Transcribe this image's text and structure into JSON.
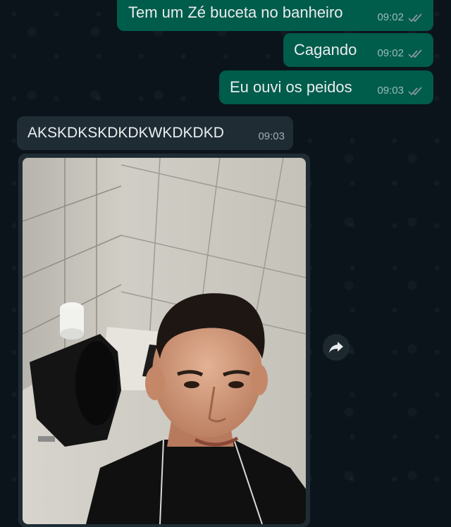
{
  "messages": [
    {
      "text": "Tem um Zé buceta no banheiro",
      "time": "09:02",
      "status": "read"
    },
    {
      "text": "Cagando",
      "time": "09:02",
      "status": "read"
    },
    {
      "text": "Eu ouvi os peidos",
      "time": "09:03",
      "status": "read"
    },
    {
      "text": "AKSKDKSKDKDKWKDKDKD",
      "time": "09:03"
    }
  ],
  "photo_message": {
    "image": "selfie-in-bathroom",
    "forward_icon": "forward-icon"
  },
  "colors": {
    "outgoing_bubble": "#005c4b",
    "incoming_bubble": "#1f2c34",
    "background": "#0b141a",
    "read_ticks": "#8696a0"
  }
}
